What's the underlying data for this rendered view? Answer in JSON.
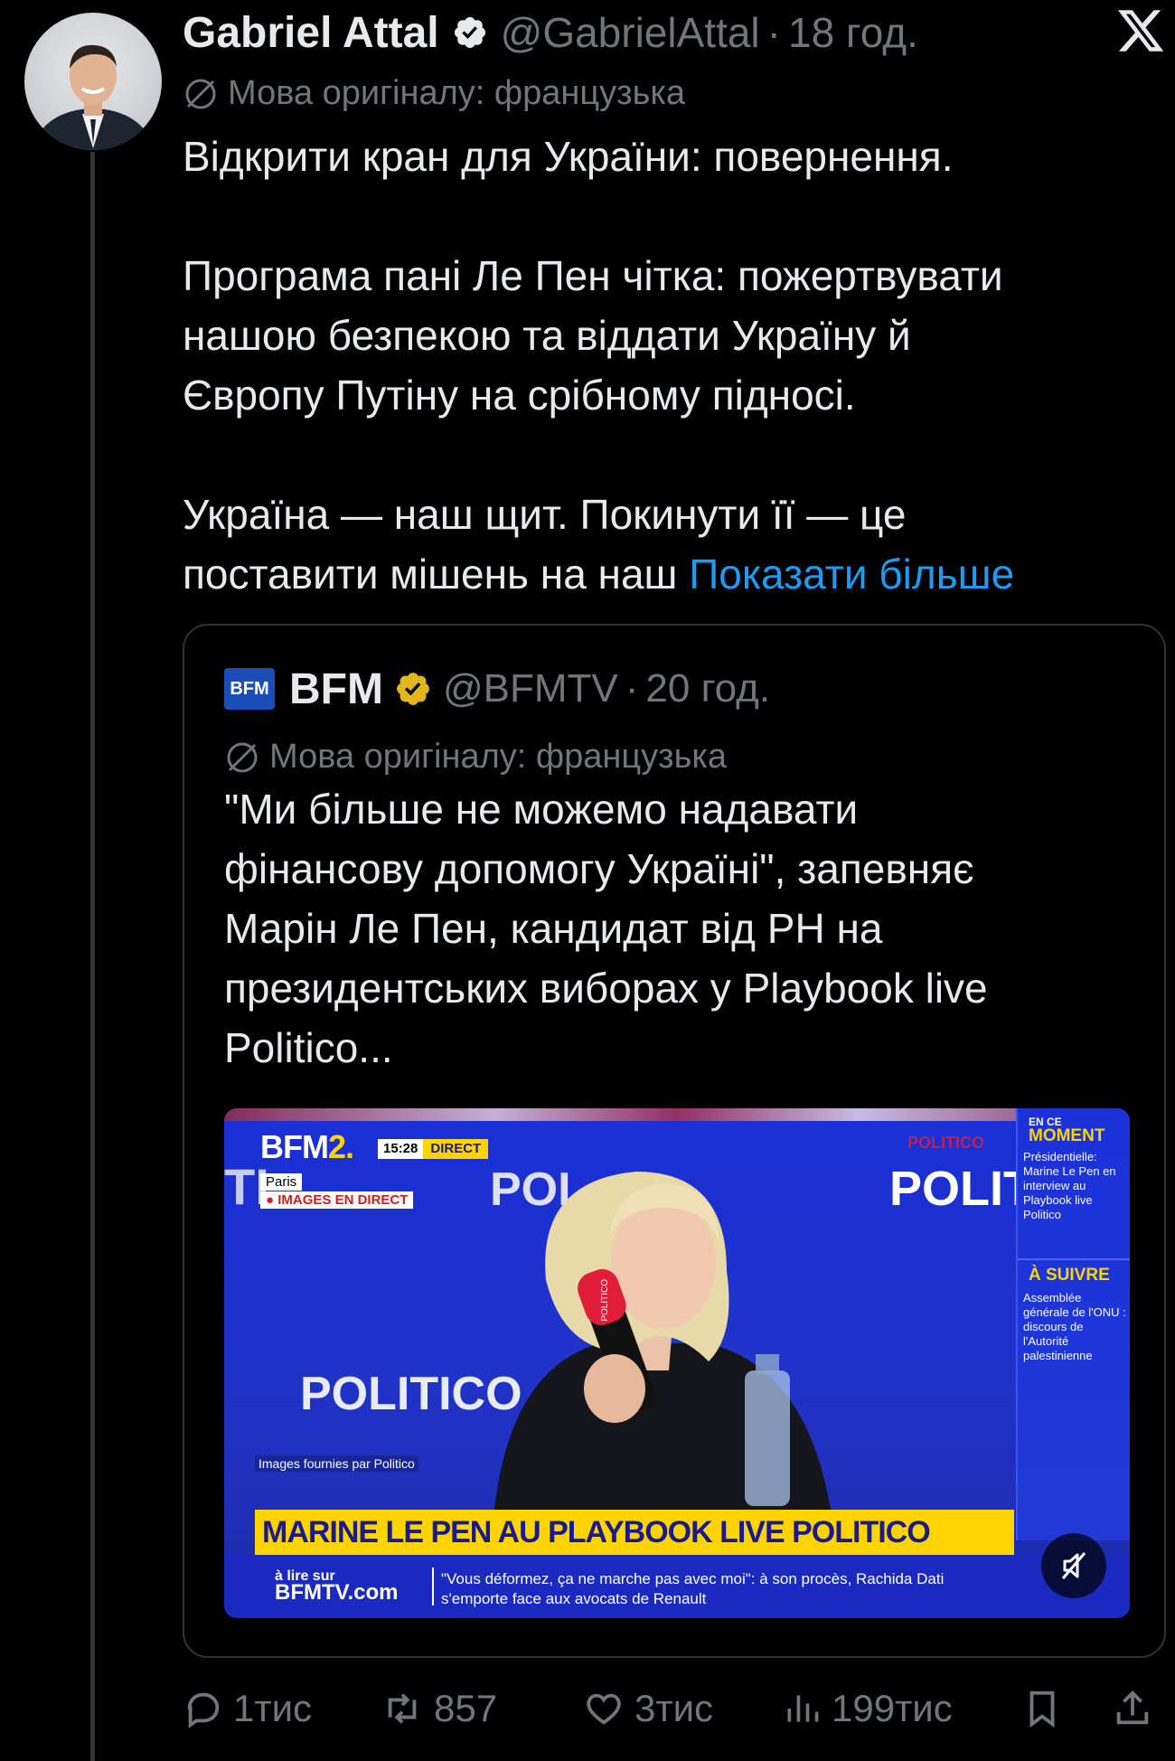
{
  "author": {
    "name": "Gabriel Attal",
    "handle": "@GabrielAttal",
    "separator": "·",
    "time": "18 год.",
    "translated_note": "Мова оригіналу: французька"
  },
  "tweet": {
    "p1": "Відкрити кран для України: повернення.",
    "p2_l1": "Програма пані Ле Пен чітка: пожертвувати",
    "p2_l2": "нашою безпекою та віддати Україну й",
    "p2_l3": "Європу Путіну на срібному підносі.",
    "p3_l1": "Україна — наш щит. Покинути її — це",
    "p3_l2": "поставити мішень на наш ",
    "show_more": "Показати більше"
  },
  "quote": {
    "logo_text": "BFM",
    "name": "BFM",
    "handle": "@BFMTV",
    "separator": "·",
    "time": "20 год.",
    "translated_note": "Мова оригіналу: французька",
    "l1": "\"Ми більше не можемо надавати",
    "l2": "фінансову допомогу Україні\", запевняє",
    "l3": "Марін Ле Пен, кандидат від РН на",
    "l4": "президентських виборах у Playbook live",
    "l5": "Politico..."
  },
  "video": {
    "channel": "BFM",
    "channel_num": "2.",
    "clock": "15:28",
    "direct": "DIRECT",
    "city": "Paris",
    "live_label": "● IMAGES EN DIRECT",
    "bg_text_left": "TI",
    "bg_text_center": "POI",
    "bg_text_right": "POLIT",
    "bg_text_red": "POLITICO",
    "bg_text_lower": "POLITICO",
    "side_en_ce": "EN CE",
    "side_moment": "MOMENT",
    "side_moment_text": "Présidentielle: Marine Le Pen en interview au Playbook live Politico",
    "side_suivre": "À SUIVRE",
    "side_suivre_text": "Assemblée générale de l'ONU : discours de l'Autorité palestinienne",
    "credit": "Images fournies par Politico",
    "headline": "MARINE LE PEN AU PLAYBOOK LIVE POLITICO",
    "alire": "à lire sur",
    "alire_site": "BFMTV.com",
    "ticker": "\"Vous déformez, ça ne marche pas avec moi\": à son procès, Rachida Dati s'emporte face aux avocats de Renault",
    "mic_label": "POLITICO"
  },
  "actions": {
    "replies": "1тис",
    "reposts": "857",
    "likes": "3тис",
    "views": "199тис"
  },
  "colors": {
    "background": "#000000",
    "text": "#e7e9ea",
    "secondary": "#71767b",
    "link": "#1d9bf0",
    "verified_blue": "#1d9bf0",
    "verified_gold": "#e2b719"
  }
}
